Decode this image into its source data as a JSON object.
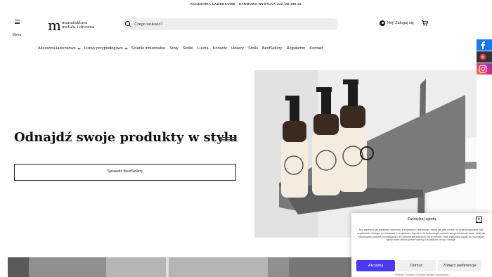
{
  "topbar": {
    "text": "AKCESORIA ŁAZIENKOWE - DARMOWA WYSYŁKA JUŻ OD 299 ZŁ"
  },
  "header": {
    "menu_label": "Menu",
    "logo": {
      "mark": "m",
      "line1": "manufaktura",
      "line2": "metalu i drewna"
    },
    "search": {
      "placeholder": "Czego szukasz?",
      "value": ""
    },
    "login_label": "Hej! Zaloguj się"
  },
  "nav": {
    "items": [
      {
        "label": "Akcesoria łazienkowe",
        "has_dropdown": true
      },
      {
        "label": "Listwy przypodłogowe",
        "has_dropdown": true
      },
      {
        "label": "Ścianki industrialne",
        "has_dropdown": false
      },
      {
        "label": "Stoły",
        "has_dropdown": false
      },
      {
        "label": "Stoliki",
        "has_dropdown": false
      },
      {
        "label": "Lustra",
        "has_dropdown": false
      },
      {
        "label": "Konsole",
        "has_dropdown": false
      },
      {
        "label": "Hokery",
        "has_dropdown": false
      },
      {
        "label": "Stołki",
        "has_dropdown": false
      },
      {
        "label": "BestSellery",
        "has_dropdown": false
      },
      {
        "label": "Regulamin",
        "has_dropdown": false
      },
      {
        "label": "Kontakt",
        "has_dropdown": false
      }
    ]
  },
  "hero": {
    "title": "Odnajdź swoje produkty w stylu",
    "button_label": "Sprawdź BestSellery"
  },
  "cookie": {
    "title": "Zarządzaj zgodą",
    "text": "Aby zapewnić jak najlepsze wrażenia, korzystamy z technologii, takich jak pliki cookie, do przechowywania i/lub uzyskiwania dostępu do informacji o urządzeniu. Zgoda na te technologie pozwoli nam przetwarzać dane, takie jak zachowanie podczas przeglądania lub unikalne identyfikatory na tej stronie. Brak wyrażenia zgody lub wycofanie zgody może niekorzystnie wpłynąć na niektóre cechy i funkcje.",
    "accept_label": "Akceptuj",
    "deny_label": "Odrzuć",
    "prefs_label": "Zobacz preferencje",
    "links": "Polityka Cookies   Ochrona danych osobowych"
  },
  "colors": {
    "accept_button": "#4a39f0",
    "facebook": "#1877f2"
  },
  "icons": [
    "menu-icon",
    "search-icon",
    "user-icon",
    "cart-icon",
    "facebook-icon",
    "instagram-icon",
    "close-icon",
    "chevron-down-icon"
  ]
}
